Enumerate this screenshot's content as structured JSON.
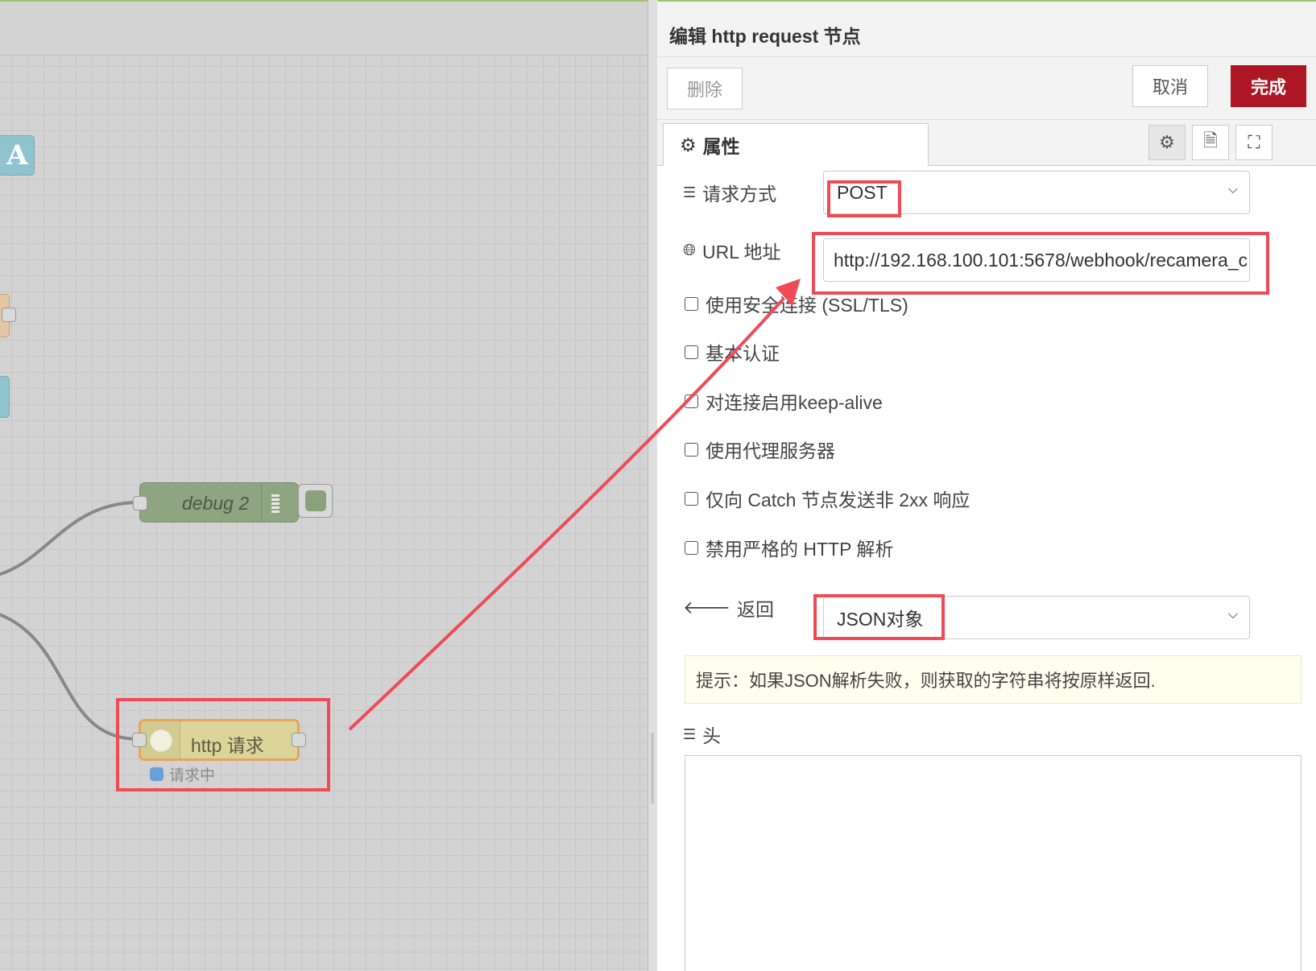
{
  "canvas": {
    "node_a_label": "A",
    "debug_node_label": "debug 2",
    "http_node_label": "http 请求",
    "http_node_status": "请求中"
  },
  "editor": {
    "title": "编辑 http request 节点",
    "buttons": {
      "delete": "删除",
      "cancel": "取消",
      "done": "完成"
    },
    "tabs": {
      "properties": "属性"
    },
    "method": {
      "label": "请求方式",
      "value": "POST"
    },
    "url": {
      "label": "URL 地址",
      "value": "http://192.168.100.101:5678/webhook/recamera_c"
    },
    "checkboxes": [
      {
        "label": "使用安全连接 (SSL/TLS)",
        "checked": false
      },
      {
        "label": "基本认证",
        "checked": false
      },
      {
        "label": "对连接启用keep-alive",
        "checked": false
      },
      {
        "label": "使用代理服务器",
        "checked": false
      },
      {
        "label": "仅向 Catch 节点发送非 2xx 响应",
        "checked": false
      },
      {
        "label": "禁用严格的 HTTP 解析",
        "checked": false
      }
    ],
    "return": {
      "label": "返回",
      "value": "JSON对象"
    },
    "tip": "提示：如果JSON解析失败，则获取的字符串将按原样返回.",
    "headers_label": "头"
  },
  "colors": {
    "done_button": "#ad1625",
    "highlight": "#ef4b57",
    "http_node": "#dcd59a",
    "debug_node": "#8fa481"
  }
}
